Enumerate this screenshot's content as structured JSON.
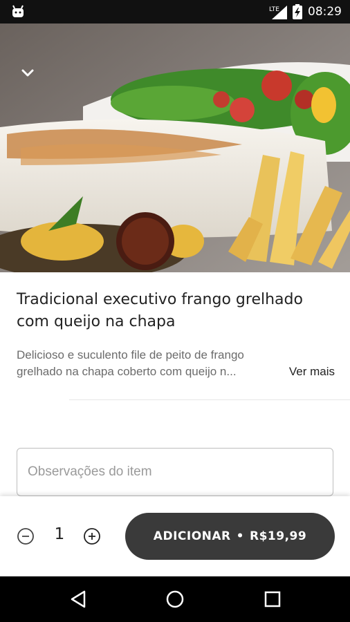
{
  "status_bar": {
    "time": "08:29",
    "network": "LTE",
    "icons": [
      "android-icon",
      "lte-signal-icon",
      "battery-charging-icon"
    ]
  },
  "hero": {
    "image": "grilled-chicken-dish-photo",
    "collapse_icon": "chevron-down-icon"
  },
  "product": {
    "title": "Tradicional executivo frango grelhado com queijo na chapa",
    "description_line1": "Delicioso e suculento file de peito de frango",
    "description_line2": "grelhado na chapa coberto com queijo n...",
    "see_more": "Ver mais"
  },
  "notes": {
    "placeholder": "Observações do item",
    "value": ""
  },
  "order": {
    "quantity": "1",
    "add_label": "ADICIONAR",
    "separator": "•",
    "price": "R$19,99"
  },
  "nav_bar": {
    "buttons": [
      "back-icon",
      "home-icon",
      "recents-icon"
    ]
  },
  "colors": {
    "button_bg": "#3a3a3a",
    "text_primary": "#222222",
    "text_secondary": "#6b6b6b",
    "status_bar": "#111111",
    "nav_bar": "#000000"
  }
}
